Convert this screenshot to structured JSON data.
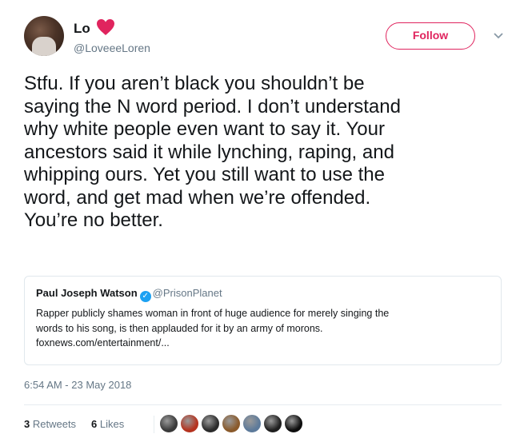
{
  "author": {
    "display_name": "Lo",
    "handle": "@LoveeeLoren",
    "heart_emoji": "red-heart",
    "heart_color": "#e0245e"
  },
  "follow_button": {
    "label": "Follow",
    "color": "#e0245e"
  },
  "menu": {
    "icon": "chevron-down-icon"
  },
  "tweet": {
    "text": "Stfu. If you aren’t black you shouldn’t be\nsaying the N word period. I don’t understand\nwhy white people even want to say it. Your\nancestors said it while lynching, raping, and\nwhipping ours. Yet you still want to use the\nword, and get mad when we’re offended.\nYou’re no better."
  },
  "quoted_tweet": {
    "display_name": "Paul Joseph Watson",
    "verified_icon": "verified-badge-icon",
    "handle": "@PrisonPlanet",
    "text": "Rapper publicly shames woman in front of huge audience for merely singing the\nwords to his song, is then applauded for it by an army of morons.\nfoxnews.com/entertainment/..."
  },
  "timestamp": "6:54 AM - 23 May 2018",
  "stats": {
    "retweets_count": "3",
    "retweets_label": "Retweets",
    "likes_count": "6",
    "likes_label": "Likes"
  },
  "likers": [
    "#3a3a3a",
    "#b5331f",
    "#2b2b2b",
    "#8a5a2b",
    "#5d7a9a",
    "#1f1f1f",
    "#0d0d0d"
  ]
}
